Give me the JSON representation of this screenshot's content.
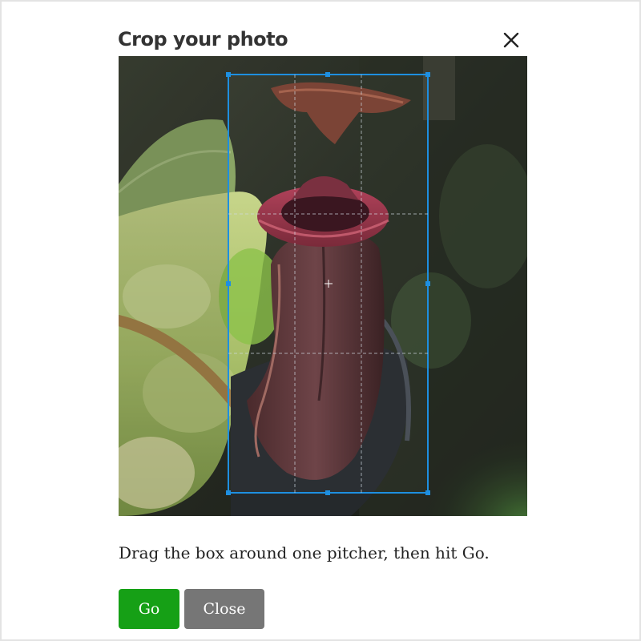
{
  "dialog": {
    "title": "Crop your photo",
    "close_icon": "close-icon"
  },
  "photo": {
    "subject": "pitcher plant photo"
  },
  "crop": {
    "handles": [
      "top-left",
      "top",
      "top-right",
      "left",
      "right",
      "bottom-left",
      "bottom",
      "bottom-right"
    ]
  },
  "instructions": "Drag the box around one pitcher, then hit Go.",
  "buttons": {
    "go_label": "Go",
    "close_label": "Close"
  },
  "colors": {
    "go": "#16a016",
    "close": "#767676",
    "crop_border": "#1e8fe0"
  }
}
